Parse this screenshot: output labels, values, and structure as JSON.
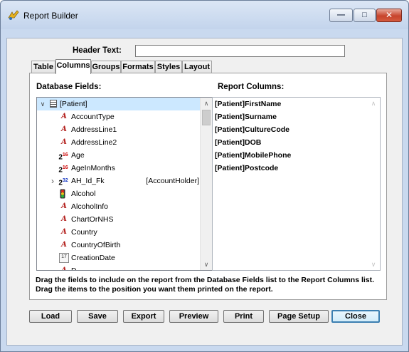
{
  "window": {
    "title": "Report Builder",
    "min_glyph": "—",
    "max_glyph": "□",
    "close_glyph": "✕"
  },
  "header": {
    "label": "Header Text:",
    "value": ""
  },
  "tabs": [
    {
      "label": "Table",
      "active": false
    },
    {
      "label": "Columns",
      "active": true
    },
    {
      "label": "Groups",
      "active": false
    },
    {
      "label": "Formats",
      "active": false
    },
    {
      "label": "Styles",
      "active": false
    },
    {
      "label": "Layout",
      "active": false
    }
  ],
  "database_fields": {
    "label": "Database Fields:",
    "root": {
      "label": "[Patient]",
      "icon": "table-icon",
      "expand_glyph": "∨"
    },
    "items": [
      {
        "label": "AccountType",
        "icon": "text-field-icon",
        "glyph": "A"
      },
      {
        "label": "AddressLine1",
        "icon": "text-field-icon",
        "glyph": "A"
      },
      {
        "label": "AddressLine2",
        "icon": "text-field-icon",
        "glyph": "A"
      },
      {
        "label": "Age",
        "icon": "int16-field-icon",
        "glyph": "2",
        "sup": "16"
      },
      {
        "label": "AgeInMonths",
        "icon": "int16-field-icon",
        "glyph": "2",
        "sup": "16"
      },
      {
        "label": "AH_Id_Fk",
        "icon": "int32-field-icon",
        "glyph": "2",
        "sup": "32",
        "tag": "[AccountHolder]",
        "expand_glyph": "›"
      },
      {
        "label": "Alcohol",
        "icon": "bool-field-icon",
        "glyph": ""
      },
      {
        "label": "AlcoholInfo",
        "icon": "text-field-icon",
        "glyph": "A"
      },
      {
        "label": "ChartOrNHS",
        "icon": "text-field-icon",
        "glyph": "A"
      },
      {
        "label": "Country",
        "icon": "text-field-icon",
        "glyph": "A"
      },
      {
        "label": "CountryOfBirth",
        "icon": "text-field-icon",
        "glyph": "A"
      },
      {
        "label": "CreationDate",
        "icon": "date-field-icon",
        "glyph": "17"
      },
      {
        "label": "D...",
        "icon": "text-field-icon",
        "glyph": "A"
      }
    ],
    "scroll_up": "∧",
    "scroll_down": "∨"
  },
  "report_columns": {
    "label": "Report Columns:",
    "items": [
      "[Patient]FirstName",
      "[Patient]Surname",
      "[Patient]CultureCode",
      "[Patient]DOB",
      "[Patient]MobilePhone",
      "[Patient]Postcode"
    ],
    "scroll_up": "∧",
    "scroll_down": "∨"
  },
  "hint": "Drag the fields to include on the report from the Database Fields list to the Report Columns list. Drag the items to the position you want them printed on the report.",
  "buttons": {
    "load": "Load",
    "save": "Save",
    "export": "Export",
    "preview": "Preview",
    "print": "Print",
    "page_setup": "Page Setup",
    "close": "Close"
  },
  "colors": {
    "selected_row": "#cce8ff",
    "text_icon": "#b3201d",
    "close_button_border": "#3c7fb1"
  }
}
